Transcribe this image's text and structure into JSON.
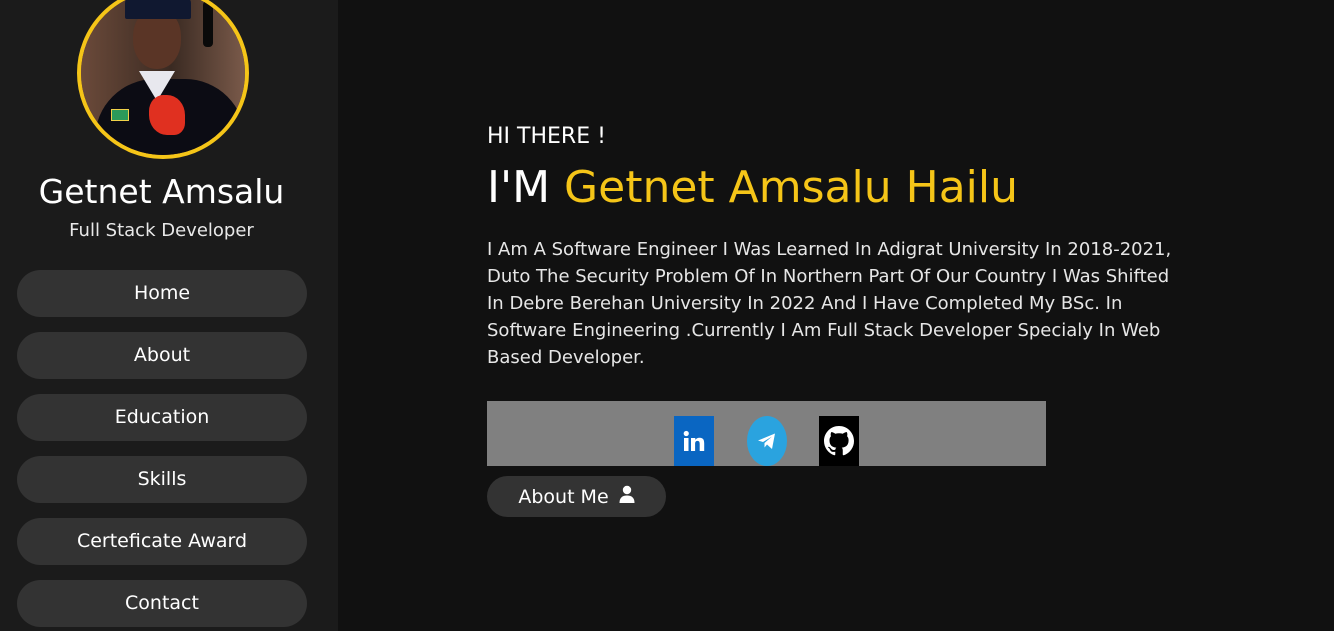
{
  "profile": {
    "name": "Getnet Amsalu",
    "role": "Full Stack Developer"
  },
  "nav": {
    "items": [
      {
        "label": "Home"
      },
      {
        "label": "About"
      },
      {
        "label": "Education"
      },
      {
        "label": "Skills"
      },
      {
        "label": "Certeficate Award"
      },
      {
        "label": "Contact"
      }
    ]
  },
  "hero": {
    "greeting": "HI THERE !",
    "prefix": "I'M",
    "full_name": "Getnet Amsalu Hailu",
    "bio": "I Am A Software Engineer I Was Learned In Adigrat University In 2018-2021, Duto The Security Problem Of In Northern Part Of Our Country I Was Shifted In Debre Berehan University In 2022 And I Have Completed My BSc. In Software Engineering .Currently I Am Full Stack Developer Specialy In Web Based Developer.",
    "about_button": "About Me"
  },
  "social": {
    "icons": [
      "linkedin-icon",
      "telegram-icon",
      "github-icon"
    ]
  },
  "colors": {
    "accent": "#f5c518",
    "background": "#111111",
    "sidebar": "#1b1b1b",
    "button": "#333333",
    "social_bar": "#808080"
  }
}
